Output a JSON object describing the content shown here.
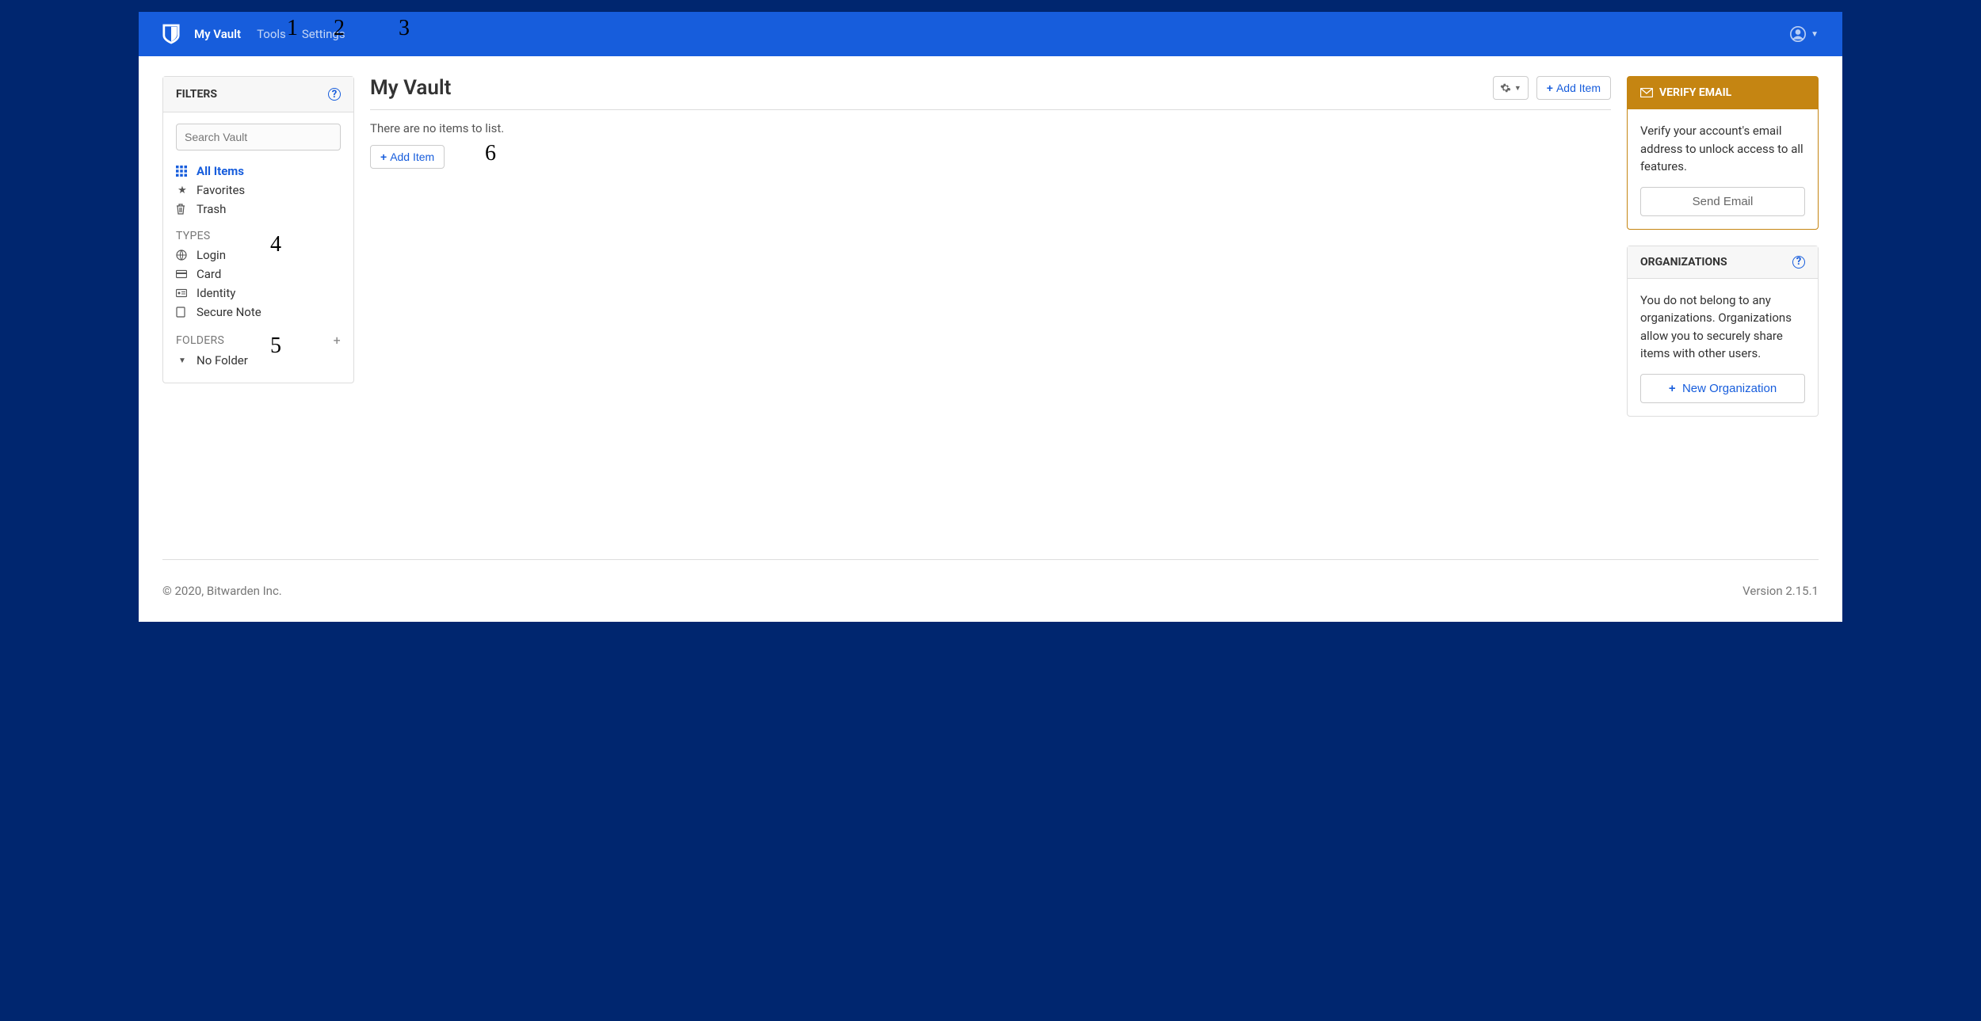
{
  "nav": {
    "items": [
      {
        "label": "My Vault",
        "active": true
      },
      {
        "label": "Tools",
        "active": false
      },
      {
        "label": "Settings",
        "active": false
      }
    ]
  },
  "annotations": [
    "1",
    "2",
    "3",
    "4",
    "5",
    "6"
  ],
  "sidebar": {
    "title": "FILTERS",
    "search_placeholder": "Search Vault",
    "main_filters": [
      {
        "label": "All Items",
        "icon": "grid-icon",
        "active": true
      },
      {
        "label": "Favorites",
        "icon": "star-icon",
        "active": false
      },
      {
        "label": "Trash",
        "icon": "trash-icon",
        "active": false
      }
    ],
    "types_label": "TYPES",
    "types": [
      {
        "label": "Login",
        "icon": "globe-icon"
      },
      {
        "label": "Card",
        "icon": "card-icon"
      },
      {
        "label": "Identity",
        "icon": "identity-icon"
      },
      {
        "label": "Secure Note",
        "icon": "note-icon"
      }
    ],
    "folders_label": "FOLDERS",
    "folders": [
      {
        "label": "No Folder"
      }
    ]
  },
  "main": {
    "title": "My Vault",
    "empty_text": "There are no items to list.",
    "add_item_label": "Add Item"
  },
  "verify_card": {
    "title": "VERIFY EMAIL",
    "body": "Verify your account's email address to unlock access to all features.",
    "button": "Send Email"
  },
  "org_card": {
    "title": "ORGANIZATIONS",
    "body": "You do not belong to any organizations. Organizations allow you to securely share items with other users.",
    "button": "New Organization"
  },
  "footer": {
    "copyright": "© 2020, Bitwarden Inc.",
    "version": "Version 2.15.1"
  }
}
